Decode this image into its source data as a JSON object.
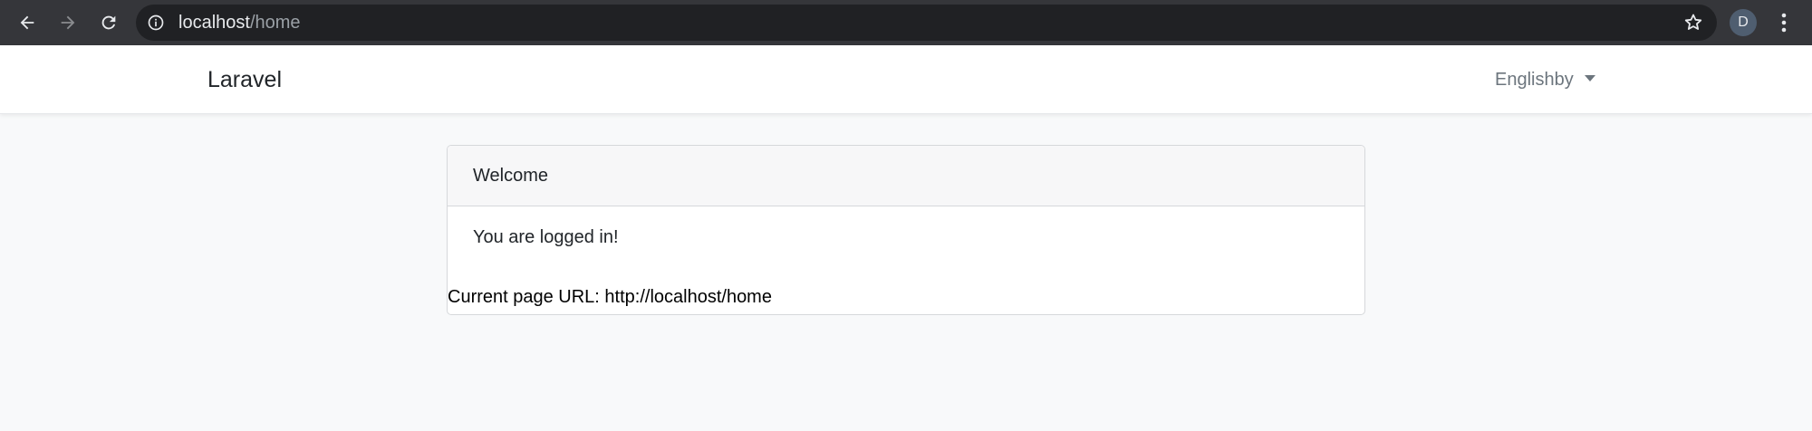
{
  "browser": {
    "address_bar": {
      "host": "localhost",
      "path": "/home"
    },
    "profile_initial": "D",
    "icons": {
      "back": "arrow-left-icon",
      "forward": "arrow-right-icon",
      "reload": "reload-icon",
      "site_info": "info-icon",
      "bookmark": "star-icon",
      "menu": "vertical-dots-icon"
    },
    "colors": {
      "chrome_bg": "#35363a",
      "omnibox_bg": "#202124",
      "avatar_bg": "#4f5e70"
    }
  },
  "navbar": {
    "brand": "Laravel",
    "language_dropdown": "Englishby"
  },
  "card": {
    "header": "Welcome",
    "body": "You are logged in!",
    "current_url_text": "Current page URL: http://localhost/home"
  },
  "colors": {
    "page_bg": "#f8f9fa",
    "card_header_bg": "#f7f7f8",
    "muted_text": "#6c757d"
  }
}
